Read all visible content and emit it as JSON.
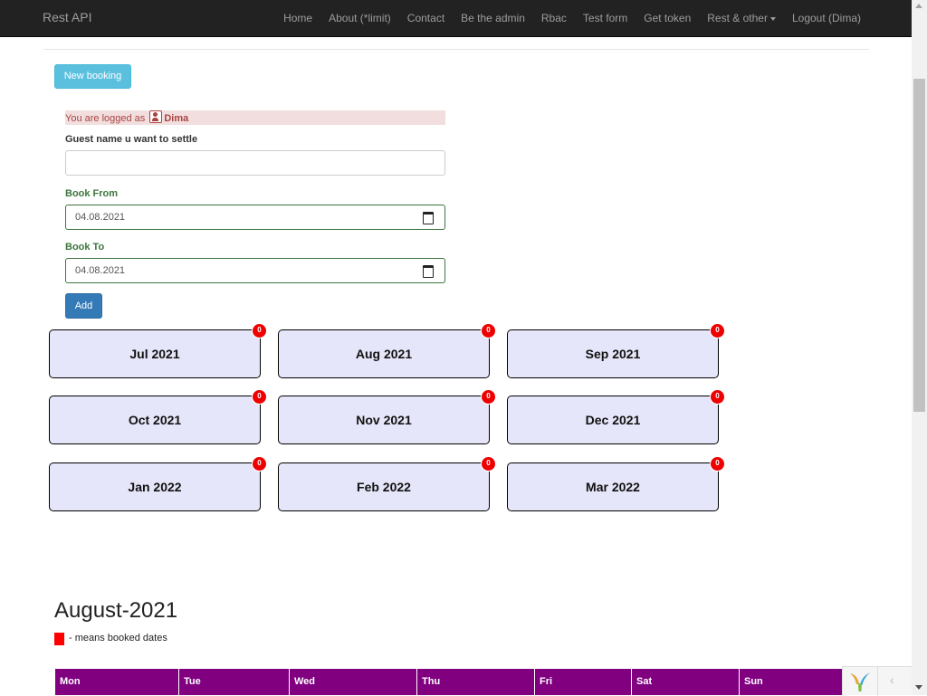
{
  "navbar": {
    "brand": "Rest API",
    "items": [
      {
        "label": "Home"
      },
      {
        "label": "About (*limit)"
      },
      {
        "label": "Contact"
      },
      {
        "label": "Be the admin"
      },
      {
        "label": "Rbac"
      },
      {
        "label": "Test form"
      },
      {
        "label": "Get token"
      },
      {
        "label": "Rest & other",
        "icon": "caret-down-icon"
      },
      {
        "label": "Logout (Dima)"
      }
    ]
  },
  "form": {
    "new_booking_label": "New booking",
    "logged_prefix": "You are logged as",
    "logged_user": "Dima",
    "guest_label": "Guest name u want to settle",
    "guest_value": "",
    "from_label": "Book From",
    "from_value": "04.08.2021",
    "to_label": "Book To",
    "to_value": "04.08.2021",
    "add_label": "Add"
  },
  "months": [
    {
      "label": "Jul 2021",
      "count": "0"
    },
    {
      "label": "Aug 2021",
      "count": "0"
    },
    {
      "label": "Sep 2021",
      "count": "0"
    },
    {
      "label": "Oct 2021",
      "count": "0"
    },
    {
      "label": "Nov 2021",
      "count": "0"
    },
    {
      "label": "Dec 2021",
      "count": "0"
    },
    {
      "label": "Jan 2022",
      "count": "0"
    },
    {
      "label": "Feb 2022",
      "count": "0"
    },
    {
      "label": "Mar 2022",
      "count": "0"
    }
  ],
  "calendar": {
    "title": "August-2021",
    "legend": "- means booked dates",
    "days": [
      "Mon",
      "Tue",
      "Wed",
      "Thu",
      "Fri",
      "Sat",
      "Sun"
    ]
  },
  "colors": {
    "navbar": "#222222",
    "month_card": "#e6e6fa",
    "badge": "#ee0000",
    "calendar_header": "#800080",
    "booked": "#ff0000"
  },
  "debug_toolbar": {
    "toggle_icon": "chevron-left-icon"
  }
}
